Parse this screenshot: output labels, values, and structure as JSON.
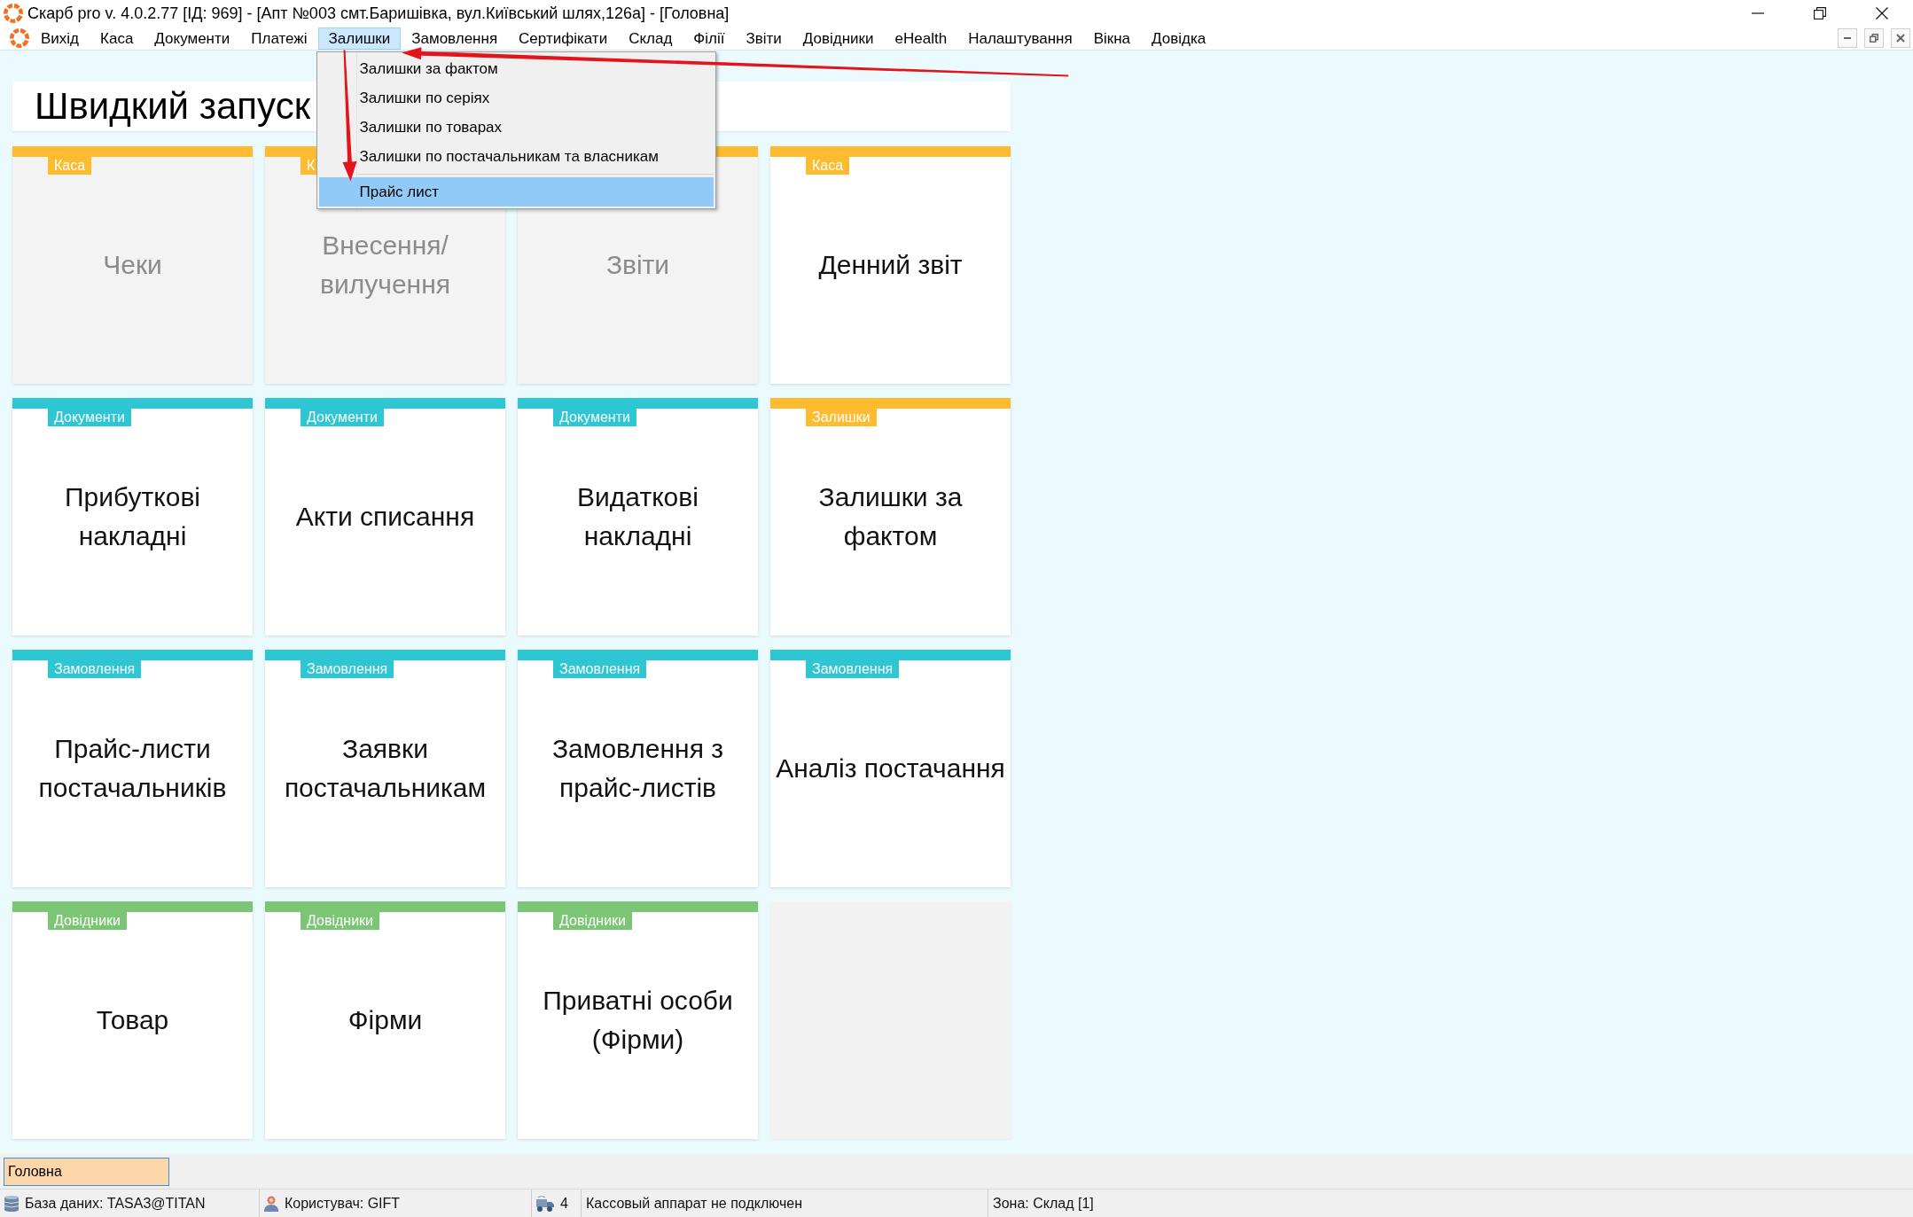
{
  "window": {
    "title": "Скарб pro v. 4.0.2.77 [ІД: 969] - [Апт №003 смт.Баришівка, вул.Київський шлях,126а] - [Головна]"
  },
  "menu_bar": {
    "items": [
      {
        "label": "Вихід",
        "selected": false
      },
      {
        "label": "Каса",
        "selected": false
      },
      {
        "label": "Документи",
        "selected": false
      },
      {
        "label": "Платежі",
        "selected": false
      },
      {
        "label": "Залишки",
        "selected": true
      },
      {
        "label": "Замовлення",
        "selected": false
      },
      {
        "label": "Сертифікати",
        "selected": false
      },
      {
        "label": "Склад",
        "selected": false
      },
      {
        "label": "Філії",
        "selected": false
      },
      {
        "label": "Звіти",
        "selected": false
      },
      {
        "label": "Довідники",
        "selected": false
      },
      {
        "label": "eHealth",
        "selected": false
      },
      {
        "label": "Налаштування",
        "selected": false
      },
      {
        "label": "Вікна",
        "selected": false
      },
      {
        "label": "Довідка",
        "selected": false
      }
    ]
  },
  "menu_dropdown": {
    "items": [
      {
        "kind": "item",
        "label": "Залишки за фактом",
        "selected": false
      },
      {
        "kind": "item",
        "label": "Залишки по серіях",
        "selected": false
      },
      {
        "kind": "item",
        "label": "Залишки по товарах",
        "selected": false
      },
      {
        "kind": "item",
        "label": "Залишки по постачальникам та власникам",
        "selected": false
      },
      {
        "kind": "separator"
      },
      {
        "kind": "item",
        "label": "Прайс лист",
        "selected": true
      }
    ]
  },
  "quick_launch": {
    "title": "Швидкий запуск",
    "tiles": [
      {
        "kind": "shortcut",
        "tag": "Каса",
        "title": "Чеки",
        "color": "#fdbc2f",
        "disabled": true
      },
      {
        "kind": "shortcut",
        "tag": "К",
        "title": "Внесення/вилучення",
        "color": "#fdbc2f",
        "disabled": true
      },
      {
        "kind": "shortcut",
        "title": "Звіти",
        "color": "#fdbc2f",
        "disabled": true
      },
      {
        "kind": "shortcut",
        "tag": "Каса",
        "title": "Денний звіт",
        "color": "#fdbc2f",
        "disabled": false
      },
      {
        "kind": "shortcut",
        "tag": "Документи",
        "title": "Прибуткові накладні",
        "color": "#2ec6d3",
        "disabled": false
      },
      {
        "kind": "shortcut",
        "tag": "Документи",
        "title": "Акти списання",
        "color": "#2ec6d3",
        "disabled": false
      },
      {
        "kind": "shortcut",
        "tag": "Документи",
        "title": "Видаткові накладні",
        "color": "#2ec6d3",
        "disabled": false
      },
      {
        "kind": "shortcut",
        "tag": "Залишки",
        "title": "Залишки за фактом",
        "color": "#fdbc2f",
        "disabled": false
      },
      {
        "kind": "shortcut",
        "tag": "Замовлення",
        "title": "Прайс-листи постачальників",
        "color": "#2ec6d3",
        "disabled": false
      },
      {
        "kind": "shortcut",
        "tag": "Замовлення",
        "title": "Заявки постачальникам",
        "color": "#2ec6d3",
        "disabled": false
      },
      {
        "kind": "shortcut",
        "tag": "Замовлення",
        "title": "Замовлення з прайс-листів",
        "color": "#2ec6d3",
        "disabled": false
      },
      {
        "kind": "shortcut",
        "tag": "Замовлення",
        "title": "Аналіз постачання",
        "color": "#2ec6d3",
        "disabled": false
      },
      {
        "kind": "shortcut",
        "tag": "Довідники",
        "title": "Товар",
        "color": "#7dc576",
        "disabled": false
      },
      {
        "kind": "shortcut",
        "tag": "Довідники",
        "title": "Фірми",
        "color": "#7dc576",
        "disabled": false
      },
      {
        "kind": "shortcut",
        "tag": "Довідники",
        "title": "Приватні особи (Фірми)",
        "color": "#7dc576",
        "disabled": false
      },
      {
        "kind": "empty"
      }
    ]
  },
  "tabs": [
    {
      "label": "Головна",
      "selected": true
    }
  ],
  "status_bar": [
    {
      "kind": "database",
      "text": "База даних: TASA3@TITAN"
    },
    {
      "kind": "user",
      "text": "Користувач: GIFT"
    },
    {
      "kind": "vehicle",
      "text": "4"
    },
    {
      "kind": "plain",
      "text": "Кассовый аппарат не подключен"
    },
    {
      "kind": "plain",
      "text": "Зона: Склад [1]"
    }
  ],
  "annotations": [
    {
      "kind": "arrow"
    },
    {
      "kind": "arrow"
    }
  ]
}
